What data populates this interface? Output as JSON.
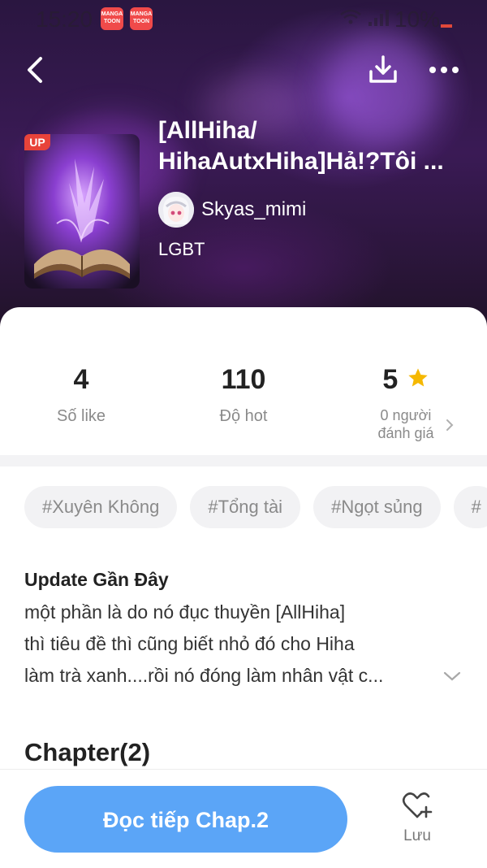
{
  "status_bar": {
    "time": "15:20",
    "battery": "10%",
    "app_icon_text": "MANGA TOON"
  },
  "book": {
    "badge": "UP",
    "title_line1": "[AllHiha/",
    "title_line2": "HihaAutxHiha]Hả!?Tôi ...",
    "author": "Skyas_mimi",
    "genre": "LGBT"
  },
  "stats": {
    "likes_value": "4",
    "likes_label": "Số like",
    "hot_value": "110",
    "hot_label": "Độ hot",
    "rating_value": "5",
    "rating_label_line1": "0 người",
    "rating_label_line2": "đánh giá"
  },
  "tags": [
    "#Xuyên Không",
    "#Tổng tài",
    "#Ngọt sủng",
    "#"
  ],
  "update": {
    "heading": "Update Gần Đây",
    "line1": "một phần là do nó đục thuyền [AllHiha]",
    "line2": "thì tiêu đề thì cũng biết nhỏ đó cho Hiha",
    "line3": "làm trà xanh....rồi nó đóng làm nhân vật c..."
  },
  "chapter_heading": "Chapter(2)",
  "bottom": {
    "read_label": "Đọc tiếp Chap.2",
    "save_label": "Lưu"
  },
  "colors": {
    "accent_blue": "#5ba5f7",
    "badge_red": "#e8433a",
    "star_yellow": "#f5b800"
  }
}
